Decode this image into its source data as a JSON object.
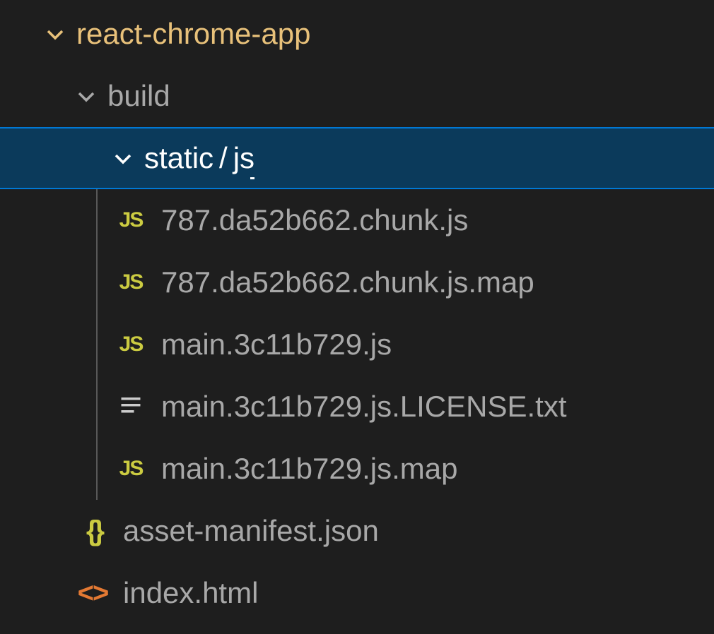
{
  "tree": {
    "root": {
      "name": "react-chrome-app",
      "expanded": true
    },
    "build": {
      "name": "build",
      "expanded": true
    },
    "staticjs": {
      "seg1": "static",
      "sep": "/",
      "seg2": "js",
      "expanded": true,
      "selected": true
    },
    "files_level3": [
      {
        "icon": "js",
        "name": "787.da52b662.chunk.js"
      },
      {
        "icon": "js",
        "name": "787.da52b662.chunk.js.map"
      },
      {
        "icon": "js",
        "name": "main.3c11b729.js"
      },
      {
        "icon": "txt",
        "name": "main.3c11b729.js.LICENSE.txt"
      },
      {
        "icon": "js",
        "name": "main.3c11b729.js.map"
      }
    ],
    "files_level2": [
      {
        "icon": "json",
        "name": "asset-manifest.json"
      },
      {
        "icon": "html",
        "name": "index.html"
      }
    ]
  },
  "icons": {
    "js_label": "JS",
    "json_label": "{ }",
    "html_label": "<>"
  }
}
